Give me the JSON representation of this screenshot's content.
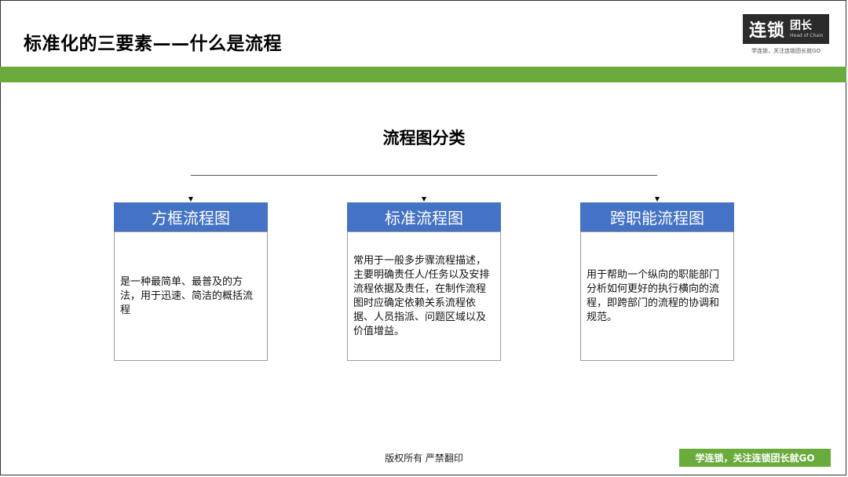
{
  "slide": {
    "title": "标准化的三要素——什么是流程",
    "heading": "流程图分类",
    "footer_text": "版权所有  严禁翻印",
    "footer_badge": "学连锁，关注连锁团长就GO"
  },
  "logo": {
    "main": "连锁",
    "side": "团长",
    "side_small": "Head of Chain",
    "tagline": "学连锁，关注连锁团长就GO"
  },
  "cards": [
    {
      "title": "方框流程图",
      "body": "是一种最简单、最普及的方法，用于迅速、简洁的概括流程"
    },
    {
      "title": "标准流程图",
      "body": "常用于一般多步骤流程描述，主要明确责任人/任务以及安排流程依据及责任，在制作流程图时应确定依赖关系流程依据、人员指派、问题区域以及价值增益。"
    },
    {
      "title": "跨职能流程图",
      "body": "用于帮助一个纵向的职能部门分析如何更好的执行横向的流程，即跨部门的流程的协调和规范。"
    }
  ],
  "colors": {
    "accent_green": "#6aac3b",
    "header_blue": "#4472c4"
  }
}
